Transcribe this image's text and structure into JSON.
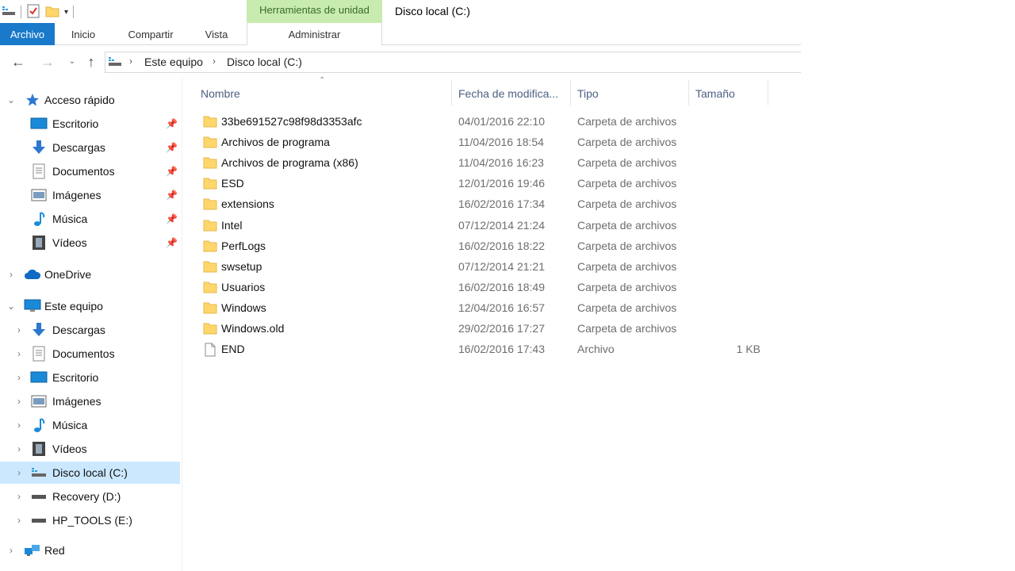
{
  "title_bar": {
    "context_tab": "Herramientas de unidad",
    "window_title": "Disco local (C:)"
  },
  "ribbon": {
    "tabs": [
      "Archivo",
      "Inicio",
      "Compartir",
      "Vista",
      "Administrar"
    ]
  },
  "address": {
    "crumbs": [
      "Este equipo",
      "Disco local (C:)"
    ]
  },
  "nav": {
    "quick_access": "Acceso rápido",
    "quick_items": [
      "Escritorio",
      "Descargas",
      "Documentos",
      "Imágenes",
      "Música",
      "Vídeos"
    ],
    "onedrive": "OneDrive",
    "this_pc": "Este equipo",
    "pc_items": [
      "Descargas",
      "Documentos",
      "Escritorio",
      "Imágenes",
      "Música",
      "Vídeos",
      "Disco local (C:)",
      "Recovery (D:)",
      "HP_TOOLS (E:)"
    ],
    "network": "Red"
  },
  "columns": [
    "Nombre",
    "Fecha de modifica...",
    "Tipo",
    "Tamaño"
  ],
  "files": [
    {
      "name": "33be691527c98f98d3353afc",
      "date": "04/01/2016 22:10",
      "type": "Carpeta de archivos",
      "size": "",
      "kind": "folder"
    },
    {
      "name": "Archivos de programa",
      "date": "11/04/2016 18:54",
      "type": "Carpeta de archivos",
      "size": "",
      "kind": "folder"
    },
    {
      "name": "Archivos de programa (x86)",
      "date": "11/04/2016 16:23",
      "type": "Carpeta de archivos",
      "size": "",
      "kind": "folder"
    },
    {
      "name": "ESD",
      "date": "12/01/2016 19:46",
      "type": "Carpeta de archivos",
      "size": "",
      "kind": "folder"
    },
    {
      "name": "extensions",
      "date": "16/02/2016 17:34",
      "type": "Carpeta de archivos",
      "size": "",
      "kind": "folder"
    },
    {
      "name": "Intel",
      "date": "07/12/2014 21:24",
      "type": "Carpeta de archivos",
      "size": "",
      "kind": "folder"
    },
    {
      "name": "PerfLogs",
      "date": "16/02/2016 18:22",
      "type": "Carpeta de archivos",
      "size": "",
      "kind": "folder"
    },
    {
      "name": "swsetup",
      "date": "07/12/2014 21:21",
      "type": "Carpeta de archivos",
      "size": "",
      "kind": "folder"
    },
    {
      "name": "Usuarios",
      "date": "16/02/2016 18:49",
      "type": "Carpeta de archivos",
      "size": "",
      "kind": "folder"
    },
    {
      "name": "Windows",
      "date": "12/04/2016 16:57",
      "type": "Carpeta de archivos",
      "size": "",
      "kind": "folder"
    },
    {
      "name": "Windows.old",
      "date": "29/02/2016 17:27",
      "type": "Carpeta de archivos",
      "size": "",
      "kind": "folder"
    },
    {
      "name": "END",
      "date": "16/02/2016 17:43",
      "type": "Archivo",
      "size": "1 KB",
      "kind": "file"
    }
  ],
  "colors": {
    "file_tab": "#1979ca",
    "context_tab": "#c8ecb0",
    "selection": "#cce8ff",
    "folder": "#ffd66b",
    "header_text": "#4d6082"
  }
}
